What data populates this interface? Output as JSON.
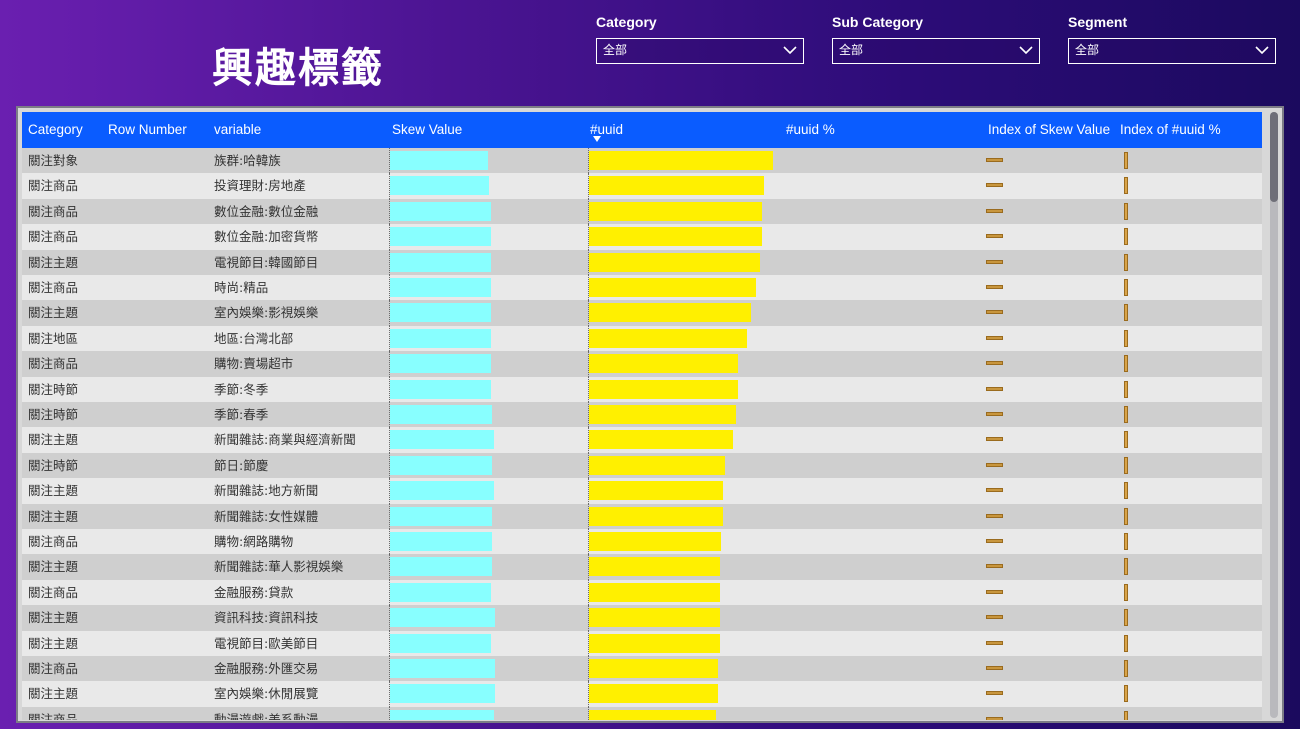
{
  "page": {
    "title": "興趣標籤"
  },
  "slicers": [
    {
      "label": "Category",
      "value": "全部"
    },
    {
      "label": "Sub Category",
      "value": "全部"
    },
    {
      "label": "Segment",
      "value": "全部"
    }
  ],
  "table": {
    "columns": [
      "Category",
      "Row Number",
      "variable",
      "Skew Value",
      "#uuid",
      "#uuid %",
      "Index of Skew Value",
      "Index of #uuid %"
    ],
    "sort": {
      "column": "#uuid",
      "direction": "descending"
    },
    "rows": [
      {
        "category": "關注對象",
        "variable": "族群:哈韓族",
        "skew": 0.66,
        "uuid": 1.0
      },
      {
        "category": "關注商品",
        "variable": "投資理財:房地產",
        "skew": 0.67,
        "uuid": 0.95
      },
      {
        "category": "關注商品",
        "variable": "數位金融:數位金融",
        "skew": 0.68,
        "uuid": 0.94
      },
      {
        "category": "關注商品",
        "variable": "數位金融:加密貨幣",
        "skew": 0.68,
        "uuid": 0.94
      },
      {
        "category": "關注主題",
        "variable": "電視節目:韓國節目",
        "skew": 0.68,
        "uuid": 0.93
      },
      {
        "category": "關注商品",
        "variable": "時尚:精品",
        "skew": 0.68,
        "uuid": 0.91
      },
      {
        "category": "關注主題",
        "variable": "室內娛樂:影視娛樂",
        "skew": 0.68,
        "uuid": 0.88
      },
      {
        "category": "關注地區",
        "variable": "地區:台灣北部",
        "skew": 0.68,
        "uuid": 0.86
      },
      {
        "category": "關注商品",
        "variable": "購物:賣場超市",
        "skew": 0.68,
        "uuid": 0.81
      },
      {
        "category": "關注時節",
        "variable": "季節:冬季",
        "skew": 0.68,
        "uuid": 0.81
      },
      {
        "category": "關注時節",
        "variable": "季節:春季",
        "skew": 0.69,
        "uuid": 0.8
      },
      {
        "category": "關注主題",
        "variable": "新聞雜誌:商業與經濟新聞",
        "skew": 0.7,
        "uuid": 0.78
      },
      {
        "category": "關注時節",
        "variable": "節日:節慶",
        "skew": 0.69,
        "uuid": 0.74
      },
      {
        "category": "關注主題",
        "variable": "新聞雜誌:地方新聞",
        "skew": 0.7,
        "uuid": 0.73
      },
      {
        "category": "關注主題",
        "variable": "新聞雜誌:女性媒體",
        "skew": 0.69,
        "uuid": 0.73
      },
      {
        "category": "關注商品",
        "variable": "購物:網路購物",
        "skew": 0.69,
        "uuid": 0.72
      },
      {
        "category": "關注主題",
        "variable": "新聞雜誌:華人影視娛樂",
        "skew": 0.69,
        "uuid": 0.71
      },
      {
        "category": "關注商品",
        "variable": "金融服務:貸款",
        "skew": 0.68,
        "uuid": 0.71
      },
      {
        "category": "關注主題",
        "variable": "資訊科技:資訊科技",
        "skew": 0.71,
        "uuid": 0.71
      },
      {
        "category": "關注主題",
        "variable": "電視節目:歐美節目",
        "skew": 0.68,
        "uuid": 0.71
      },
      {
        "category": "關注商品",
        "variable": "金融服務:外匯交易",
        "skew": 0.71,
        "uuid": 0.7
      },
      {
        "category": "關注主題",
        "variable": "室內娛樂:休閒展覽",
        "skew": 0.71,
        "uuid": 0.7
      },
      {
        "category": "關注商品",
        "variable": "動漫遊戲:美系動漫",
        "skew": 0.7,
        "uuid": 0.69
      }
    ]
  },
  "colors": {
    "header_bg": "#0a5cff",
    "skew_bar": "#88ffff",
    "uuid_bar": "#fff000",
    "index_marker": "#c8963e",
    "row_odd": "#cfcfcf",
    "row_even": "#e9e9e9"
  },
  "icons": {
    "slicer_dropdown": "chevron-down-icon",
    "sort": "sort-descending-icon"
  }
}
